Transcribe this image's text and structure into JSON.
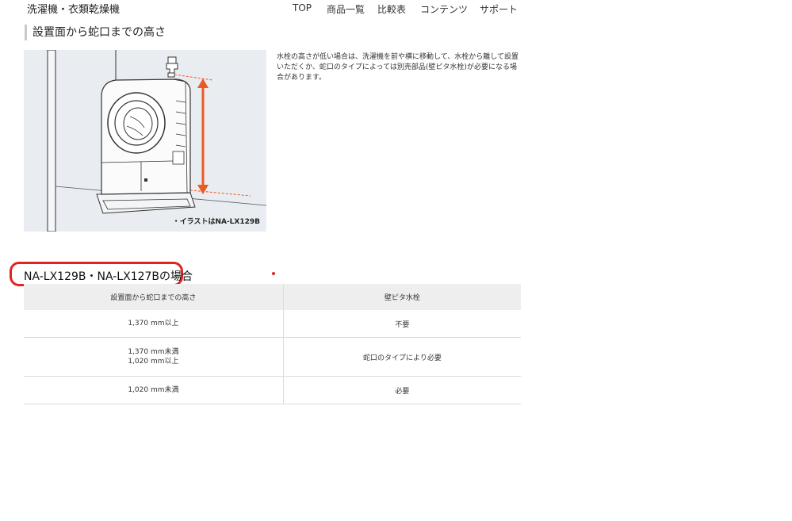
{
  "header": {
    "brand": "洗濯機・衣類乾燥機",
    "nav": [
      "TOP",
      "商品一覧",
      "比較表",
      "コンテンツ",
      "サポート"
    ]
  },
  "section": {
    "title": "設置面から蛇口までの高さ"
  },
  "illustration": {
    "caption": "・イラストはNA-LX129B"
  },
  "description": "水栓の高さが低い場合は、洗濯機を前や横に移動して、水栓から離して設置いただくか、蛇口のタイプによっては別売部品(壁ピタ水栓)が必要になる場合があります。",
  "model_title": "NA-LX129B・NA-LX127Bの場合",
  "table": {
    "headers": [
      "設置面から蛇口までの高さ",
      "壁ピタ水栓"
    ],
    "rows": [
      {
        "height_lines": [
          "1,370 mm以上"
        ],
        "required": "不要"
      },
      {
        "height_lines": [
          "1,370 mm未満",
          "1,020 mm以上"
        ],
        "required": "蛇口のタイプにより必要"
      },
      {
        "height_lines": [
          "1,020 mm未満"
        ],
        "required": "必要"
      }
    ]
  },
  "colors": {
    "accent_arrow": "#ea5a24",
    "highlight": "#e32323"
  }
}
